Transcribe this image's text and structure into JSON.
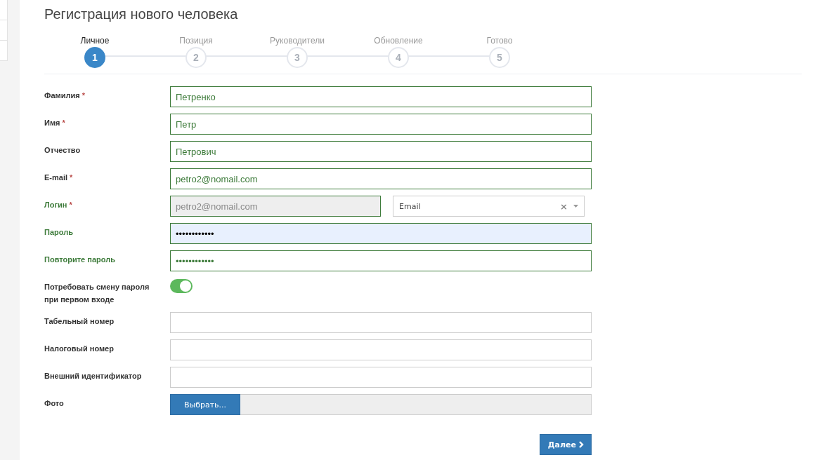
{
  "title": "Регистрация нового человека",
  "steps": [
    {
      "label": "Личное",
      "number": "1",
      "selected": true
    },
    {
      "label": "Позиция",
      "number": "2",
      "selected": false
    },
    {
      "label": "Руководители",
      "number": "3",
      "selected": false
    },
    {
      "label": "Обновление",
      "number": "4",
      "selected": false
    },
    {
      "label": "Готово",
      "number": "5",
      "selected": false
    }
  ],
  "fields": [
    {
      "kind": "text",
      "label": "Фамилия",
      "required_mark": "*",
      "value": "Петренко",
      "valid": true,
      "label_highlighted": false
    },
    {
      "kind": "text",
      "label": "Имя",
      "required_mark": "*",
      "value": "Петр",
      "valid": true,
      "label_highlighted": false
    },
    {
      "kind": "text",
      "label": "Отчество",
      "value": "Петрович",
      "valid": true,
      "label_highlighted": false
    },
    {
      "kind": "text",
      "label": "E-mail",
      "required_mark": "*",
      "value": "petro2@nomail.com",
      "valid": true,
      "label_highlighted": false
    },
    {
      "kind": "login",
      "label": "Логин",
      "required_mark": "*",
      "value": "petro2@nomail.com",
      "valid": true,
      "disabled": true,
      "label_highlighted": true,
      "select_value": "Email",
      "clear_glyph": "×"
    },
    {
      "kind": "password",
      "label": "Пароль",
      "value": "••••••••••••",
      "valid": true,
      "autofilled": true,
      "label_highlighted": true
    },
    {
      "kind": "password",
      "label": "Повторите пароль",
      "value": "••••••••••••",
      "valid": true,
      "autofilled": false,
      "label_highlighted": true
    },
    {
      "kind": "toggle",
      "label": "Потребовать смену пароля при первом входе",
      "on": true,
      "label_highlighted": false
    },
    {
      "kind": "text",
      "label": "Табельный номер",
      "valid": false,
      "label_highlighted": false
    },
    {
      "kind": "text",
      "label": "Налоговый номер",
      "valid": false,
      "label_highlighted": false
    },
    {
      "kind": "text",
      "label": "Внешний идентификатор",
      "valid": false,
      "label_highlighted": false
    },
    {
      "kind": "file",
      "label": "Фото",
      "button": "Выбрать...",
      "label_highlighted": false
    }
  ],
  "next_button": "Далее"
}
